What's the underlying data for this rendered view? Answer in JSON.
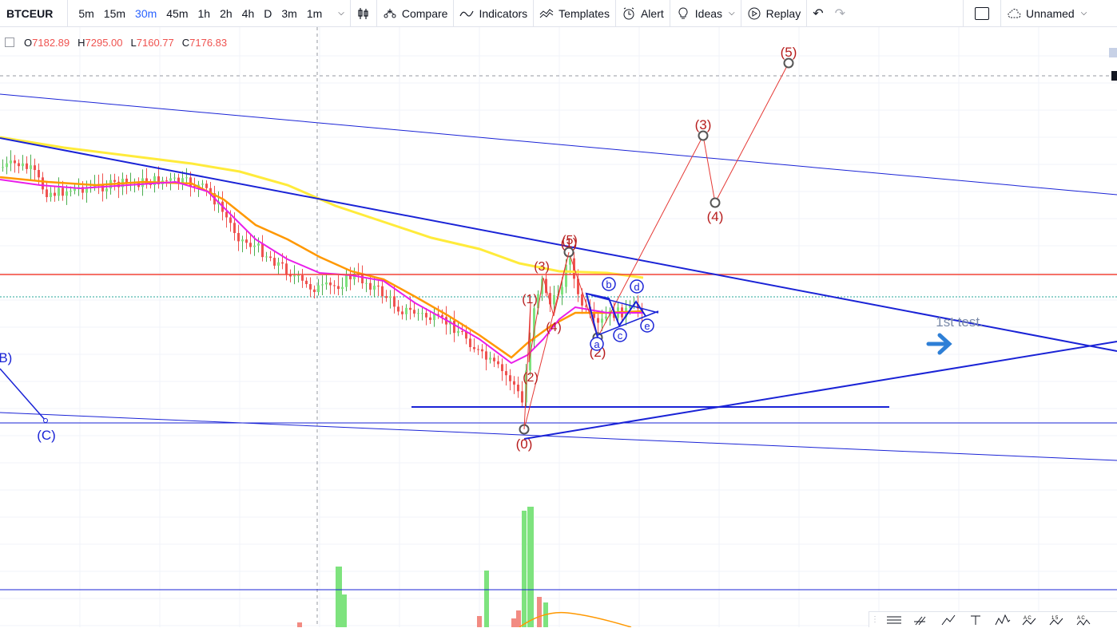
{
  "toolbar": {
    "symbol": "BTCEUR",
    "intervals": [
      "5m",
      "15m",
      "30m",
      "45m",
      "1h",
      "2h",
      "4h",
      "D",
      "3m",
      "1m"
    ],
    "active_interval": "30m",
    "compare_label": "Compare",
    "indicators_label": "Indicators",
    "templates_label": "Templates",
    "alert_label": "Alert",
    "ideas_label": "Ideas",
    "replay_label": "Replay",
    "layout_name": "Unnamed"
  },
  "ohlc": {
    "o_key": "O",
    "o_val": "7182.89",
    "h_key": "H",
    "h_val": "7295.00",
    "l_key": "L",
    "l_val": "7160.77",
    "c_key": "C",
    "c_val": "7176.83"
  },
  "chart_data": {
    "type": "candlestick",
    "symbol": "BTCEUR",
    "interval": "30m",
    "last_candle": {
      "open": 7182.89,
      "high": 7295.0,
      "low": 7160.77,
      "close": 7176.83
    },
    "annotations": {
      "wave_labels_big": [
        "(0)",
        "(1)",
        "(2)",
        "(3)",
        "(4)",
        "(5)"
      ],
      "wave_labels_small": [
        "(1)",
        "(2)",
        "(3)",
        "(4)",
        "(5)"
      ],
      "triangle_labels": [
        "a",
        "b",
        "c",
        "d",
        "e"
      ],
      "corrective_labels": [
        "(B)",
        "(C)"
      ],
      "note": "1st test."
    },
    "colors": {
      "bull": "#26a69a",
      "bear": "#ef5350",
      "ma_yellow": "#ffeb3b",
      "ma_orange": "#ff9800",
      "ma_magenta": "#e91ee9",
      "wave": "#b71c1c",
      "trendline": "#1a23d6",
      "horizontal_red": "#f44336"
    }
  },
  "drawbar_icons": [
    "horizontal-lines-icon",
    "fib-icon",
    "pitchfork-icon",
    "text-icon",
    "pattern-icon",
    "abc-icon",
    "15-icon",
    "abcde-icon"
  ]
}
